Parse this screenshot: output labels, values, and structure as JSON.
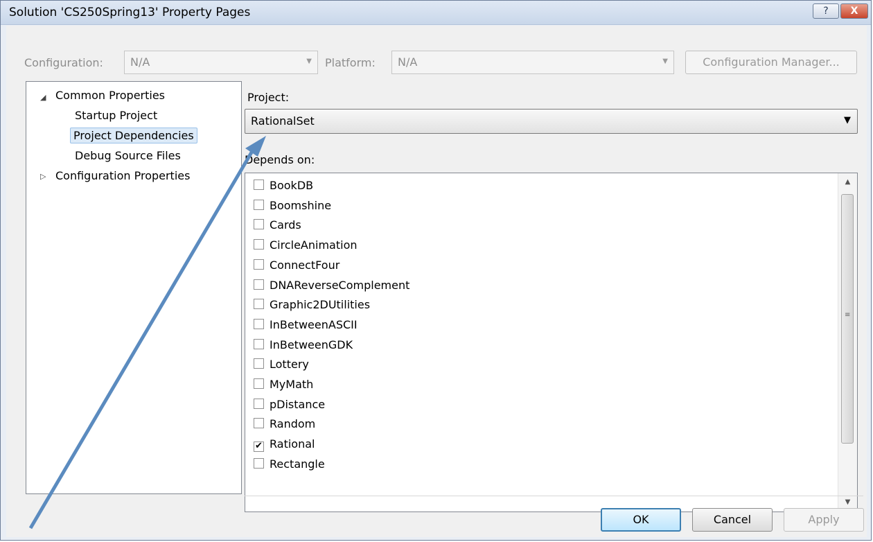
{
  "window": {
    "title": "Solution 'CS250Spring13' Property Pages"
  },
  "titlebar": {
    "help_label": "?",
    "close_label": "X"
  },
  "toolbar": {
    "configuration_label": "Configuration:",
    "configuration_value": "N/A",
    "platform_label": "Platform:",
    "platform_value": "N/A",
    "config_manager_label": "Configuration Manager..."
  },
  "tree": {
    "common": "Common Properties",
    "startup": "Startup Project",
    "dependencies": "Project Dependencies",
    "debug_source": "Debug Source Files",
    "config_props": "Configuration Properties"
  },
  "main": {
    "project_label": "Project:",
    "project_value": "RationalSet",
    "depends_label": "Depends on:",
    "depends": [
      {
        "name": "BookDB",
        "checked": false
      },
      {
        "name": "Boomshine",
        "checked": false
      },
      {
        "name": "Cards",
        "checked": false
      },
      {
        "name": "CircleAnimation",
        "checked": false
      },
      {
        "name": "ConnectFour",
        "checked": false
      },
      {
        "name": "DNAReverseComplement",
        "checked": false
      },
      {
        "name": "Graphic2DUtilities",
        "checked": false
      },
      {
        "name": "InBetweenASCII",
        "checked": false
      },
      {
        "name": "InBetweenGDK",
        "checked": false
      },
      {
        "name": "Lottery",
        "checked": false
      },
      {
        "name": "MyMath",
        "checked": false
      },
      {
        "name": "pDistance",
        "checked": false
      },
      {
        "name": "Random",
        "checked": false
      },
      {
        "name": "Rational",
        "checked": true
      },
      {
        "name": "Rectangle",
        "checked": false
      }
    ]
  },
  "buttons": {
    "ok": "OK",
    "cancel": "Cancel",
    "apply": "Apply"
  },
  "colors": {
    "annotation_arrow": "#5b8bbf",
    "selection": "#dceaf8"
  }
}
